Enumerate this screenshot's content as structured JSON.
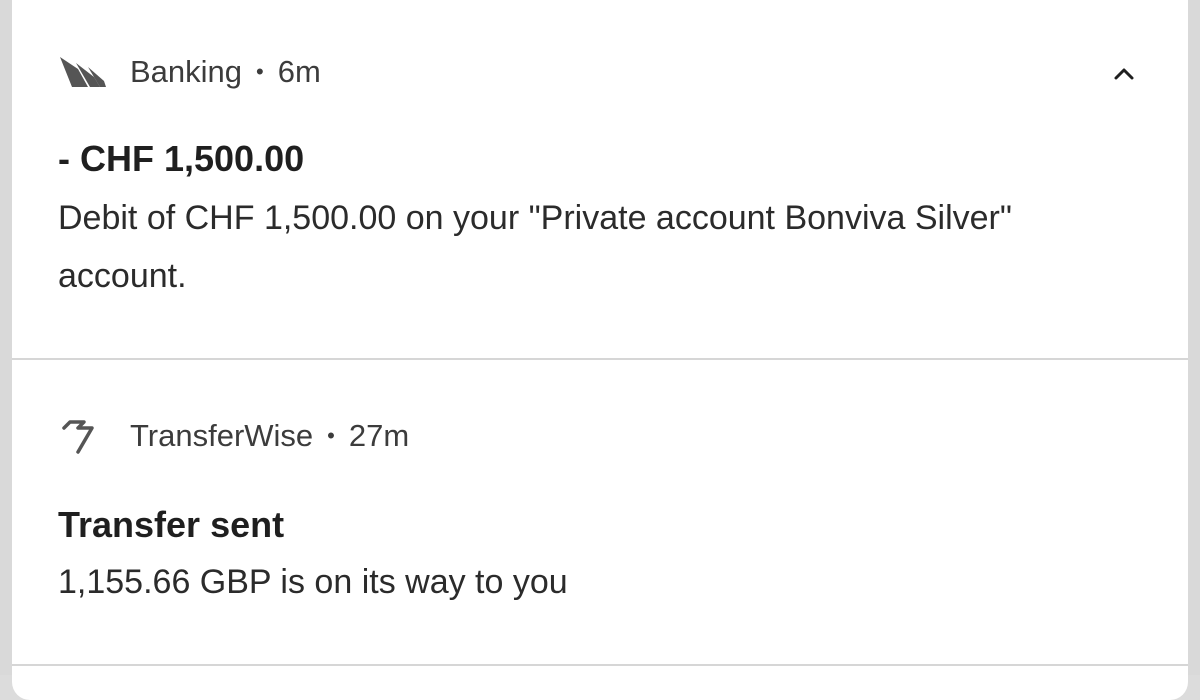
{
  "notifications": [
    {
      "app_icon": "bank-sails-icon",
      "app_name": "Banking",
      "separator": "•",
      "time": "6m",
      "expand_icon": "chevron-up-icon",
      "title": "- CHF 1,500.00",
      "body": "Debit of CHF 1,500.00 on your \"Private account Bonviva Silver\" account."
    },
    {
      "app_icon": "transferwise-flag-icon",
      "app_name": "TransferWise",
      "separator": "•",
      "time": "27m",
      "title": "Transfer sent",
      "body": "1,155.66 GBP is on its way to you"
    }
  ],
  "colors": {
    "panel": "#ffffff",
    "background": "#d9d9d9",
    "divider": "#d6d6d6",
    "header_text": "#3c3c3c",
    "title_text": "#1f1f1f",
    "icon": "#555555"
  }
}
